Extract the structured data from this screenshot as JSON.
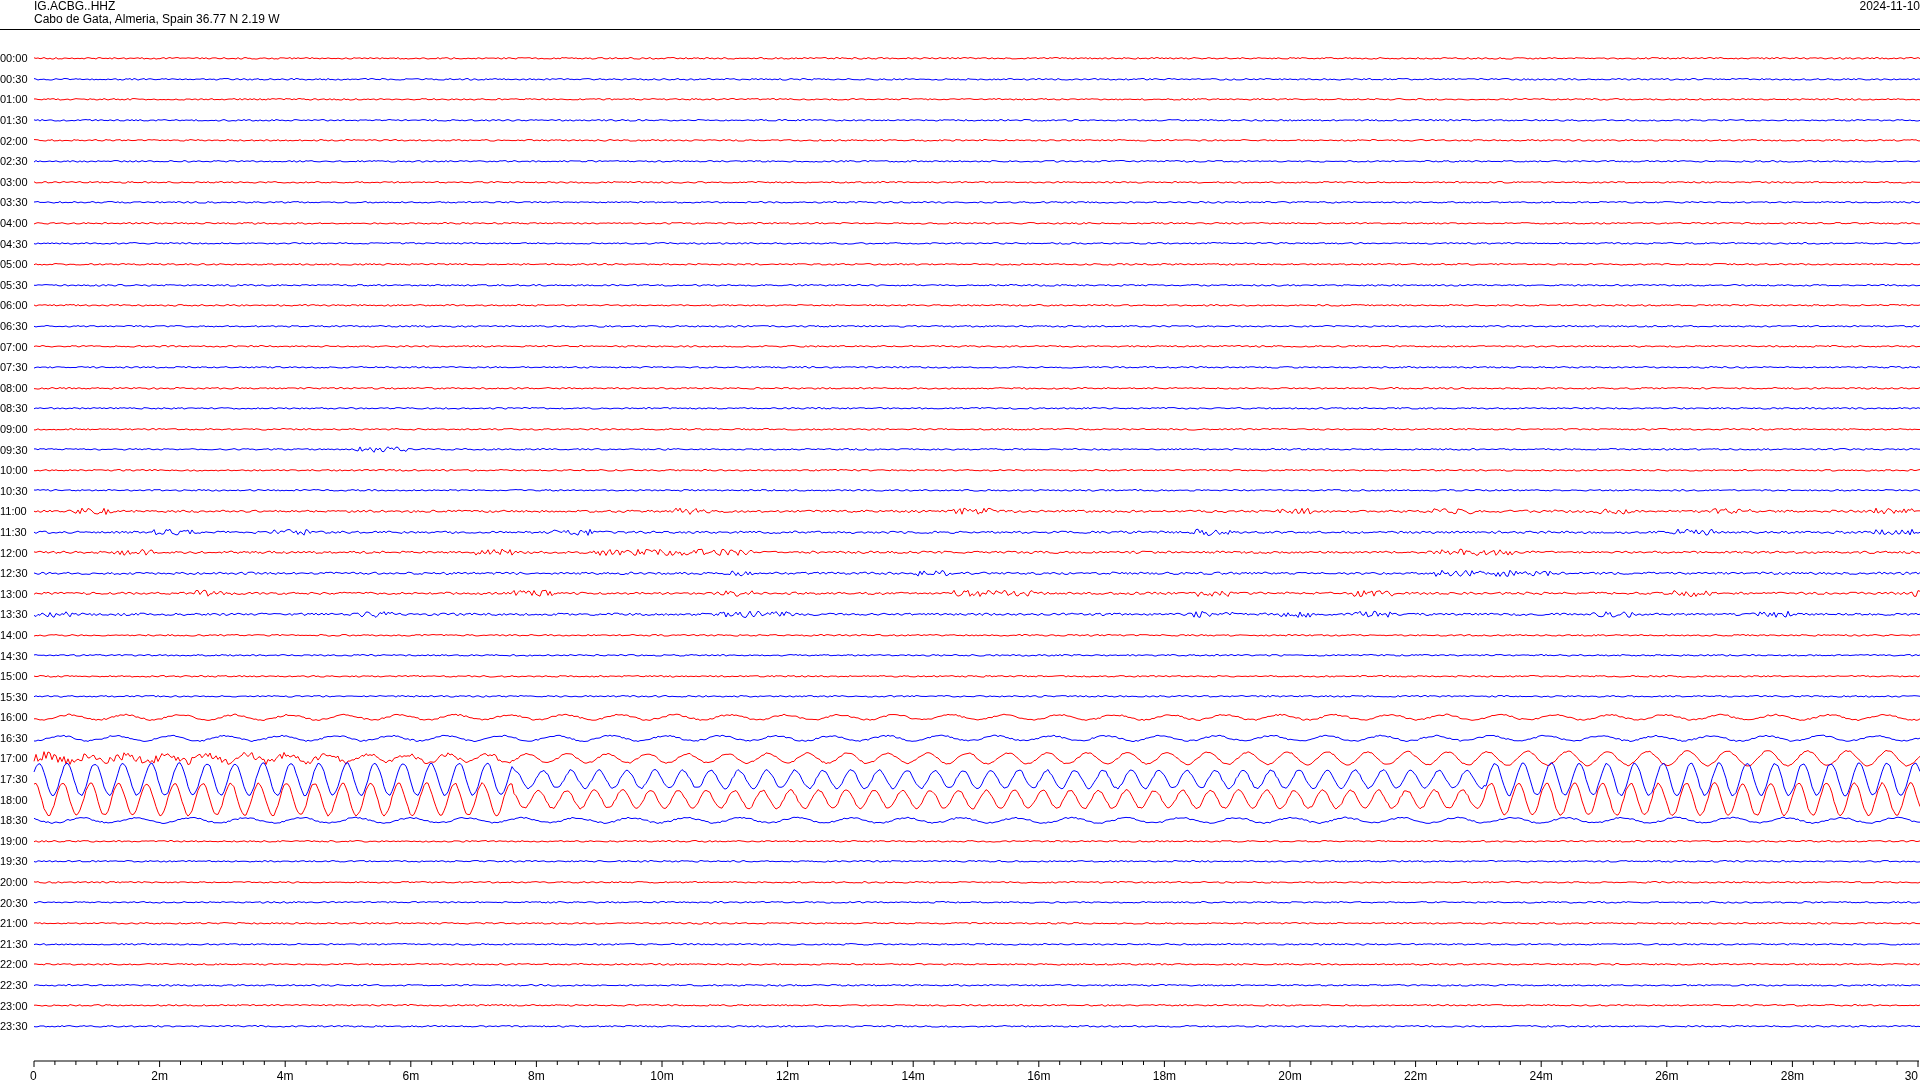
{
  "header": {
    "station": "IG.ACBG..HHZ",
    "location": "Cabo de Gata, Almeria, Spain  36.77 N 2.19 W",
    "date": "2024-11-10"
  },
  "rows": [
    {
      "time": "00:00",
      "color": "#ff0000",
      "kind": "quiet"
    },
    {
      "time": "00:30",
      "color": "#0000ff",
      "kind": "quiet"
    },
    {
      "time": "01:00",
      "color": "#ff0000",
      "kind": "quiet"
    },
    {
      "time": "01:30",
      "color": "#0000ff",
      "kind": "quiet"
    },
    {
      "time": "02:00",
      "color": "#ff0000",
      "kind": "quiet"
    },
    {
      "time": "02:30",
      "color": "#0000ff",
      "kind": "quiet"
    },
    {
      "time": "03:00",
      "color": "#ff0000",
      "kind": "quiet"
    },
    {
      "time": "03:30",
      "color": "#0000ff",
      "kind": "quiet"
    },
    {
      "time": "04:00",
      "color": "#ff0000",
      "kind": "quiet"
    },
    {
      "time": "04:30",
      "color": "#0000ff",
      "kind": "quiet"
    },
    {
      "time": "05:00",
      "color": "#ff0000",
      "kind": "quiet"
    },
    {
      "time": "05:30",
      "color": "#0000ff",
      "kind": "quiet"
    },
    {
      "time": "06:00",
      "color": "#ff0000",
      "kind": "quiet"
    },
    {
      "time": "06:30",
      "color": "#0000ff",
      "kind": "quiet"
    },
    {
      "time": "07:00",
      "color": "#ff0000",
      "kind": "quiet"
    },
    {
      "time": "07:30",
      "color": "#0000ff",
      "kind": "quiet"
    },
    {
      "time": "08:00",
      "color": "#ff0000",
      "kind": "quiet"
    },
    {
      "time": "08:30",
      "color": "#0000ff",
      "kind": "quiet"
    },
    {
      "time": "09:00",
      "color": "#ff0000",
      "kind": "quiet"
    },
    {
      "time": "09:30",
      "color": "#0000ff",
      "kind": "burst"
    },
    {
      "time": "10:00",
      "color": "#ff0000",
      "kind": "quiet"
    },
    {
      "time": "10:30",
      "color": "#0000ff",
      "kind": "quiet"
    },
    {
      "time": "11:00",
      "color": "#ff0000",
      "kind": "noisy"
    },
    {
      "time": "11:30",
      "color": "#0000ff",
      "kind": "noisy"
    },
    {
      "time": "12:00",
      "color": "#ff0000",
      "kind": "noisy"
    },
    {
      "time": "12:30",
      "color": "#0000ff",
      "kind": "noisy"
    },
    {
      "time": "13:00",
      "color": "#ff0000",
      "kind": "noisy"
    },
    {
      "time": "13:30",
      "color": "#0000ff",
      "kind": "noisy"
    },
    {
      "time": "14:00",
      "color": "#ff0000",
      "kind": "quiet"
    },
    {
      "time": "14:30",
      "color": "#0000ff",
      "kind": "quiet"
    },
    {
      "time": "15:00",
      "color": "#ff0000",
      "kind": "quiet"
    },
    {
      "time": "15:30",
      "color": "#0000ff",
      "kind": "quiet"
    },
    {
      "time": "16:00",
      "color": "#ff0000",
      "kind": "swell"
    },
    {
      "time": "16:30",
      "color": "#0000ff",
      "kind": "swell"
    },
    {
      "time": "17:00",
      "color": "#ff0000",
      "kind": "quake"
    },
    {
      "time": "17:30",
      "color": "#0000ff",
      "kind": "wave"
    },
    {
      "time": "18:00",
      "color": "#ff0000",
      "kind": "wave"
    },
    {
      "time": "18:30",
      "color": "#0000ff",
      "kind": "swell"
    },
    {
      "time": "19:00",
      "color": "#ff0000",
      "kind": "quiet"
    },
    {
      "time": "19:30",
      "color": "#0000ff",
      "kind": "quiet"
    },
    {
      "time": "20:00",
      "color": "#ff0000",
      "kind": "quiet"
    },
    {
      "time": "20:30",
      "color": "#0000ff",
      "kind": "quiet"
    },
    {
      "time": "21:00",
      "color": "#ff0000",
      "kind": "quiet"
    },
    {
      "time": "21:30",
      "color": "#0000ff",
      "kind": "quiet"
    },
    {
      "time": "22:00",
      "color": "#ff0000",
      "kind": "quiet"
    },
    {
      "time": "22:30",
      "color": "#0000ff",
      "kind": "quiet"
    },
    {
      "time": "23:00",
      "color": "#ff0000",
      "kind": "quiet"
    },
    {
      "time": "23:30",
      "color": "#0000ff",
      "kind": "quiet"
    }
  ],
  "x_axis": {
    "labels": [
      "0",
      "2m",
      "4m",
      "6m",
      "8m",
      "10m",
      "12m",
      "14m",
      "16m",
      "18m",
      "20m",
      "22m",
      "24m",
      "26m",
      "28m",
      "30"
    ]
  }
}
